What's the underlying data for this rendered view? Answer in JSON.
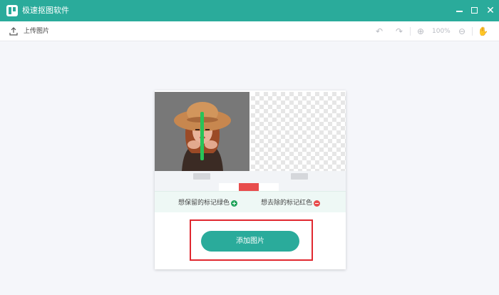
{
  "window": {
    "title": "极速抠图软件",
    "close_glyph": "✕"
  },
  "toolbar": {
    "upload_label": "上传图片",
    "zoom_level": "100%",
    "undo_glyph": "↶",
    "redo_glyph": "↷",
    "zoom_in_glyph": "⊕",
    "zoom_out_glyph": "⊖",
    "hand_glyph": "✋"
  },
  "hints": {
    "keep": "想保留的标记绿色",
    "remove": "想去除的标记红色"
  },
  "main": {
    "add_image_label": "添加图片"
  },
  "colors": {
    "accent": "#2aab9b",
    "keep_marker": "#21a35b",
    "remove_marker": "#e84c4c",
    "highlight_frame": "#e0282f"
  },
  "icons": [
    "upload-icon",
    "undo-icon",
    "redo-icon",
    "zoom-in-icon",
    "zoom-out-icon",
    "hand-icon",
    "plus-circle-icon",
    "minus-circle-icon"
  ]
}
